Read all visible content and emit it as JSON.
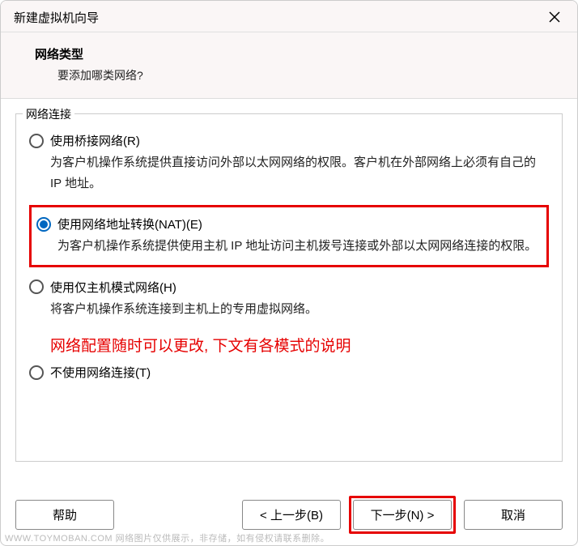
{
  "titlebar": {
    "title": "新建虚拟机向导"
  },
  "header": {
    "title": "网络类型",
    "subtitle": "要添加哪类网络?"
  },
  "fieldset": {
    "legend": "网络连接"
  },
  "options": {
    "bridged": {
      "label": "使用桥接网络(R)",
      "desc": "为客户机操作系统提供直接访问外部以太网网络的权限。客户机在外部网络上必须有自己的 IP 地址。"
    },
    "nat": {
      "label": "使用网络地址转换(NAT)(E)",
      "desc": "为客户机操作系统提供使用主机 IP 地址访问主机拨号连接或外部以太网网络连接的权限。"
    },
    "hostonly": {
      "label": "使用仅主机模式网络(H)",
      "desc": "将客户机操作系统连接到主机上的专用虚拟网络。"
    },
    "none": {
      "label": "不使用网络连接(T)"
    }
  },
  "annotation": "网络配置随时可以更改, 下文有各模式的说明",
  "buttons": {
    "help": "帮助",
    "back": "< 上一步(B)",
    "next": "下一步(N) >",
    "cancel": "取消"
  },
  "watermark": "WWW.TOYMOBAN.COM  网络图片仅供展示，非存储，如有侵权请联系删除。"
}
